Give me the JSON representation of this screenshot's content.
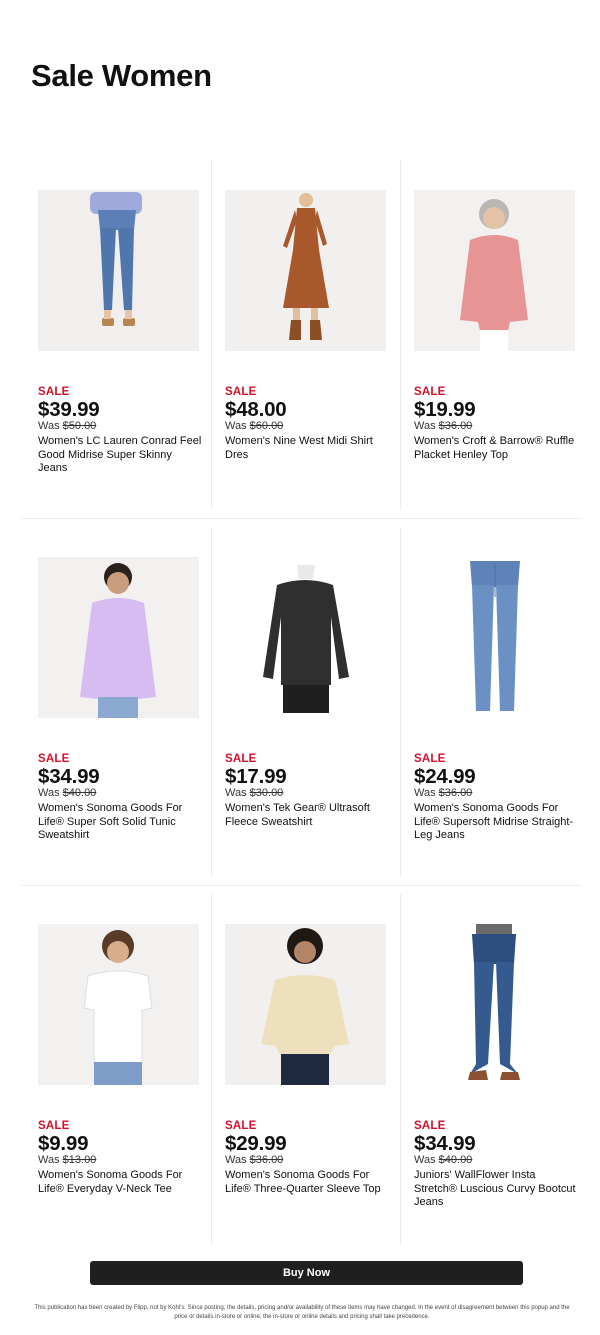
{
  "page": {
    "title": "Sale Women"
  },
  "products": [
    {
      "badge": "SALE",
      "price": "$39.99",
      "was_prefix": "Was ",
      "was_price": "$50.00",
      "name": "Women's LC Lauren Conrad Feel Good Midrise Super Skinny Jeans",
      "image": "woman-jeans-photo"
    },
    {
      "badge": "SALE",
      "price": "$48.00",
      "was_prefix": "Was ",
      "was_price": "$60.00",
      "name": "Women's Nine West Midi Shirt Dres",
      "image": "woman-dress-photo"
    },
    {
      "badge": "SALE",
      "price": "$19.99",
      "was_prefix": "Was ",
      "was_price": "$36.00",
      "name": "Women's Croft & Barrow® Ruffle Placket Henley Top",
      "image": "woman-henley-top-photo"
    },
    {
      "badge": "SALE",
      "price": "$34.99",
      "was_prefix": "Was ",
      "was_price": "$40.00",
      "name": "Women's Sonoma Goods For Life® Super Soft Solid Tunic Sweatshirt",
      "image": "woman-tunic-sweatshirt-photo"
    },
    {
      "badge": "SALE",
      "price": "$17.99",
      "was_prefix": "Was ",
      "was_price": "$30.00",
      "name": "Women's Tek Gear® Ultrasoft Fleece Sweatshirt",
      "image": "fleece-sweatshirt-mannequin-photo"
    },
    {
      "badge": "SALE",
      "price": "$24.99",
      "was_prefix": "Was ",
      "was_price": "$36.00",
      "name": "Women's Sonoma Goods For Life® Supersoft Midrise Straight-Leg Jeans",
      "image": "straight-leg-jeans-photo"
    },
    {
      "badge": "SALE",
      "price": "$9.99",
      "was_prefix": "Was ",
      "was_price": "$13.00",
      "name": "Women's Sonoma Goods For Life® Everyday V-Neck Tee",
      "image": "woman-vneck-tee-photo"
    },
    {
      "badge": "SALE",
      "price": "$29.99",
      "was_prefix": "Was ",
      "was_price": "$36.00",
      "name": "Women's Sonoma Goods For Life® Three-Quarter Sleeve Top",
      "image": "woman-three-quarter-top-photo"
    },
    {
      "badge": "SALE",
      "price": "$34.99",
      "was_prefix": "Was ",
      "was_price": "$40.00",
      "name": "Juniors' WallFlower Insta Stretch® Luscious Curvy Bootcut Jeans",
      "image": "bootcut-jeans-photo"
    }
  ],
  "cta": {
    "label": "Buy Now"
  },
  "footer": {
    "disclaimer": "This publication has been created by Flipp, not by Kohl's. Since posting, the details, pricing and/or availability of these items may have changed. In the event of disagreement between this popup and the price or details in-store or online, the in-store or online details and pricing shall take precedence."
  },
  "colors": {
    "sale_red": "#d0112b",
    "button_bg": "#1f1f1f",
    "divider": "#ececec"
  }
}
